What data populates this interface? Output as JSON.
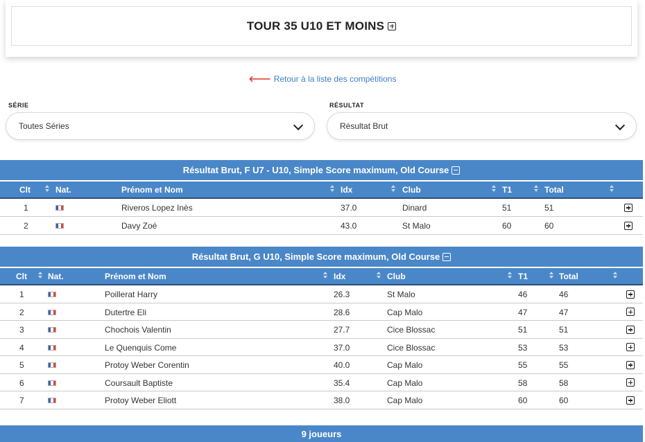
{
  "competition": {
    "title": "TOUR 35 U10 ET MOINS"
  },
  "back_link": {
    "label": "Retour à la liste des compétitions"
  },
  "filters": {
    "serie": {
      "label": "SÉRIE",
      "value": "Toutes Séries"
    },
    "resultat": {
      "label": "RÉSULTAT",
      "value": "Résultat Brut"
    }
  },
  "groups": [
    {
      "title": "Résultat Brut, F U7 - U10, Simple Score maximum, Old Course",
      "columns": {
        "rank": "Clt",
        "nat": "Nat.",
        "name": "Prénom et Nom",
        "idx": "Idx",
        "club": "Club",
        "t1": "T1",
        "total": "Total"
      },
      "rows": [
        {
          "rank": "1",
          "name": "Riveros Lopez Inès",
          "idx": "37.0",
          "club": "Dinard",
          "t1": "51",
          "total": "51"
        },
        {
          "rank": "2",
          "name": "Davy Zoé",
          "idx": "43.0",
          "club": "St Malo",
          "t1": "60",
          "total": "60"
        }
      ]
    },
    {
      "title": "Résultat Brut, G U10, Simple Score maximum, Old Course",
      "columns": {
        "rank": "Clt",
        "nat": "Nat.",
        "name": "Prénom et Nom",
        "idx": "Idx",
        "club": "Club",
        "t1": "T1",
        "total": "Total"
      },
      "rows": [
        {
          "rank": "1",
          "name": "Poillerat Harry",
          "idx": "26.3",
          "club": "St Malo",
          "t1": "46",
          "total": "46"
        },
        {
          "rank": "2",
          "name": "Dutertre Eli",
          "idx": "28.6",
          "club": "Cap Malo",
          "t1": "47",
          "total": "47"
        },
        {
          "rank": "3",
          "name": "Chochois Valentin",
          "idx": "27.7",
          "club": "Cice Blossac",
          "t1": "51",
          "total": "51"
        },
        {
          "rank": "4",
          "name": "Le Quenquis Come",
          "idx": "37.0",
          "club": "Cice Blossac",
          "t1": "53",
          "total": "53"
        },
        {
          "rank": "5",
          "name": "Protoy Weber Corentin",
          "idx": "40.0",
          "club": "Cap Malo",
          "t1": "55",
          "total": "55"
        },
        {
          "rank": "6",
          "name": "Coursault Baptiste",
          "idx": "35.4",
          "club": "Cap Malo",
          "t1": "58",
          "total": "58"
        },
        {
          "rank": "7",
          "name": "Protoy Weber Eliott",
          "idx": "38.0",
          "club": "Cap Malo",
          "t1": "60",
          "total": "60"
        }
      ]
    }
  ],
  "footer": {
    "players_count": "9 joueurs"
  },
  "colors": {
    "header_blue": "#4a87c8",
    "link_blue": "#3d7fc2",
    "arrow_red": "#d9342b"
  },
  "icons": {
    "nationality_flag": "france-flag-icon",
    "row_expand": "plus-square-icon",
    "group_collapse": "minus-square-icon"
  }
}
